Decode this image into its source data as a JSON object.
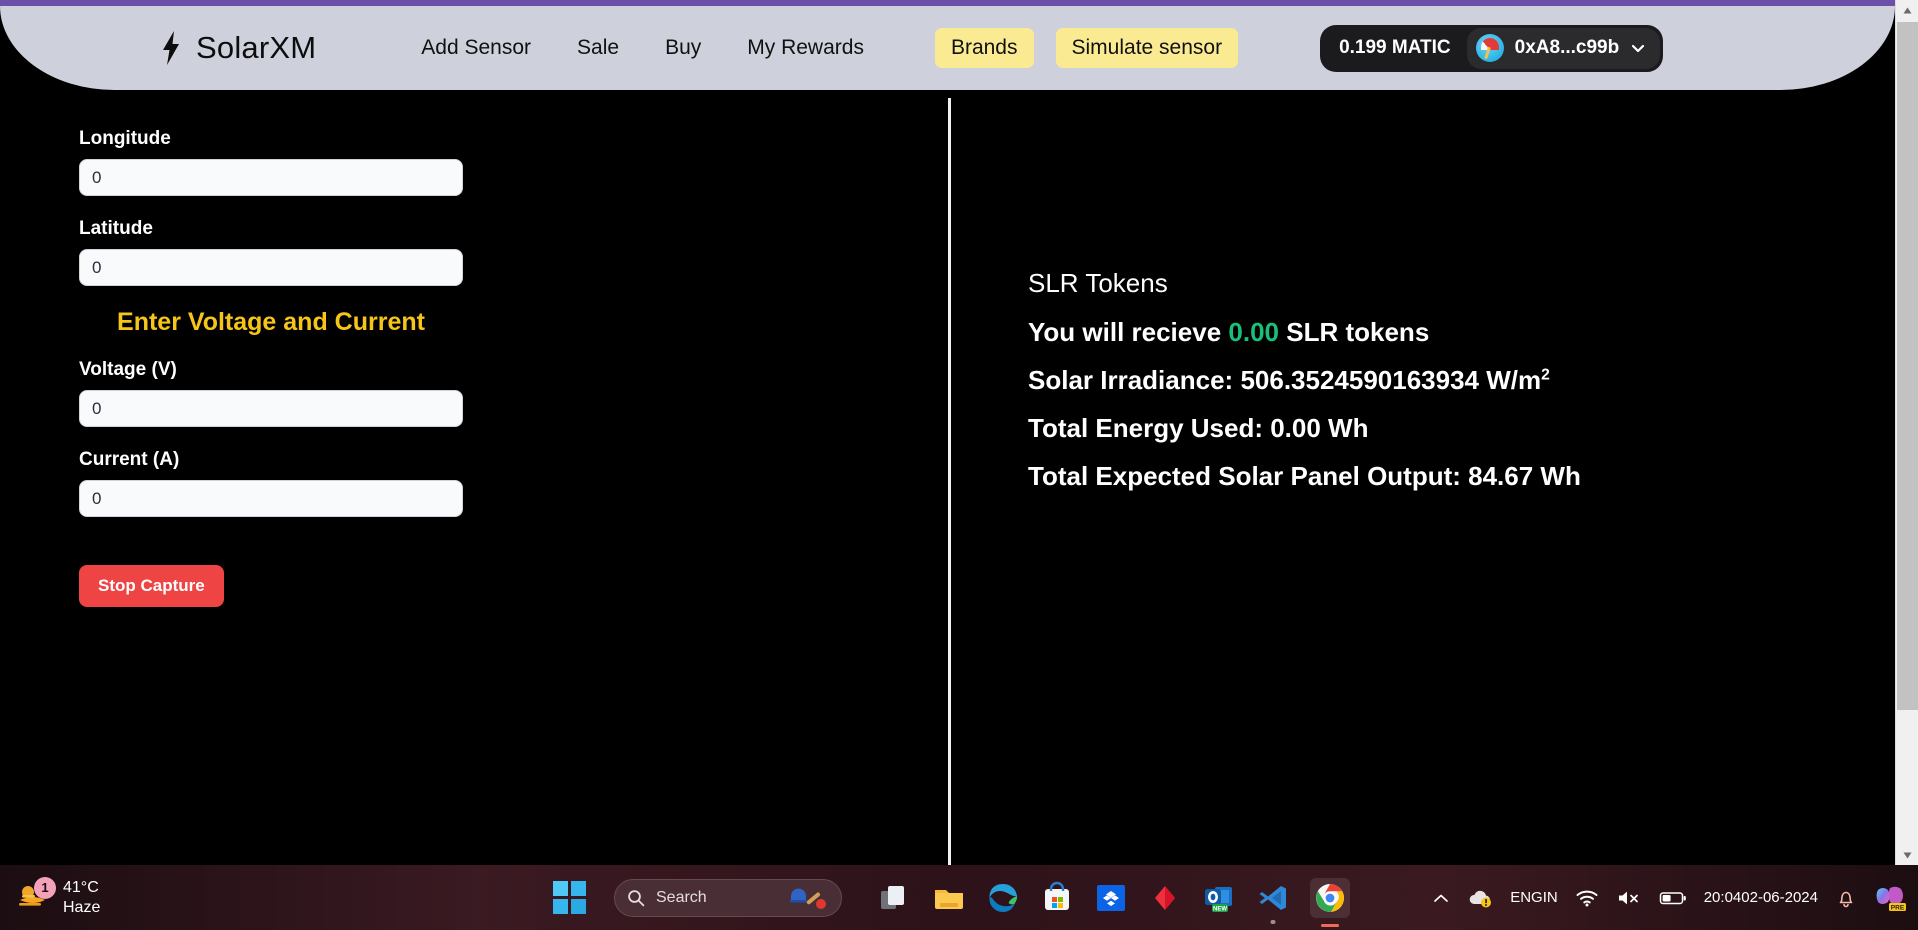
{
  "app": {
    "brand_name": "SolarXM",
    "brand_icon": "lightning-bolt-icon",
    "accent_purple": "#6b4fa8",
    "navbar_bg": "#ced1dc",
    "page_bg": "#000000"
  },
  "nav": {
    "links": [
      {
        "label": "Add Sensor"
      },
      {
        "label": "Sale"
      },
      {
        "label": "Buy"
      },
      {
        "label": "My Rewards"
      }
    ],
    "pills": [
      {
        "label": "Brands",
        "color": "#faeb92"
      },
      {
        "label": "Simulate sensor",
        "color": "#faeb92"
      }
    ],
    "wallet": {
      "balance": "0.199 MATIC",
      "address": "0xA8...c99b",
      "avatar_icon": "wallet-avatar-icon",
      "chevron_icon": "chevron-down-icon"
    }
  },
  "form": {
    "longitude": {
      "label": "Longitude",
      "value": "0",
      "placeholder": "0"
    },
    "latitude": {
      "label": "Latitude",
      "value": "0",
      "placeholder": "0"
    },
    "section_title": "Enter Voltage and Current",
    "section_title_color": "#f5c518",
    "voltage": {
      "label": "Voltage (V)",
      "value": "0",
      "placeholder": "0"
    },
    "current": {
      "label": "Current (A)",
      "value": "0",
      "placeholder": "0"
    },
    "stop_button": {
      "label": "Stop Capture",
      "color": "#ef4444"
    }
  },
  "readout": {
    "heading": "SLR Tokens",
    "receive_prefix": "You will recieve",
    "receive_amount": "0.00",
    "receive_suffix": "SLR tokens",
    "receive_amount_color": "#18c07a",
    "irradiance_label": "Solar Irradiance:",
    "irradiance_value": "506.3524590163934 W/m",
    "irradiance_exponent": "2",
    "energy_used": "Total Energy Used: 0.00 Wh",
    "expected_output": "Total Expected Solar Panel Output: 84.67 Wh"
  },
  "scrollbar": {
    "up_icon": "scroll-up-arrow-icon",
    "down_icon": "scroll-down-arrow-icon"
  },
  "taskbar": {
    "weather": {
      "temperature": "41°C",
      "condition": "Haze",
      "badge_count": "1",
      "icon": "weather-haze-icon"
    },
    "start_icon": "windows-start-icon",
    "search": {
      "placeholder": "Search",
      "icon": "search-icon",
      "widget_icon": "cricket-widget-icon"
    },
    "apps": [
      {
        "name": "task-view-icon"
      },
      {
        "name": "file-explorer-icon"
      },
      {
        "name": "microsoft-edge-icon"
      },
      {
        "name": "microsoft-store-icon"
      },
      {
        "name": "dropbox-icon"
      },
      {
        "name": "adobe-icon"
      },
      {
        "name": "outlook-new-icon"
      },
      {
        "name": "vs-code-icon"
      },
      {
        "name": "google-chrome-icon"
      }
    ],
    "tray": {
      "overflow_icon": "chevron-up-icon",
      "onedrive_icon": "onedrive-warning-icon",
      "language": "ENG",
      "region": "IN",
      "wifi_icon": "wifi-icon",
      "volume_icon": "volume-muted-icon",
      "battery_icon": "battery-icon",
      "time": "20:04",
      "date": "02-06-2024",
      "notification_icon": "bell-icon",
      "copilot_icon": "copilot-preview-icon",
      "copilot_badge": "PRE"
    }
  }
}
